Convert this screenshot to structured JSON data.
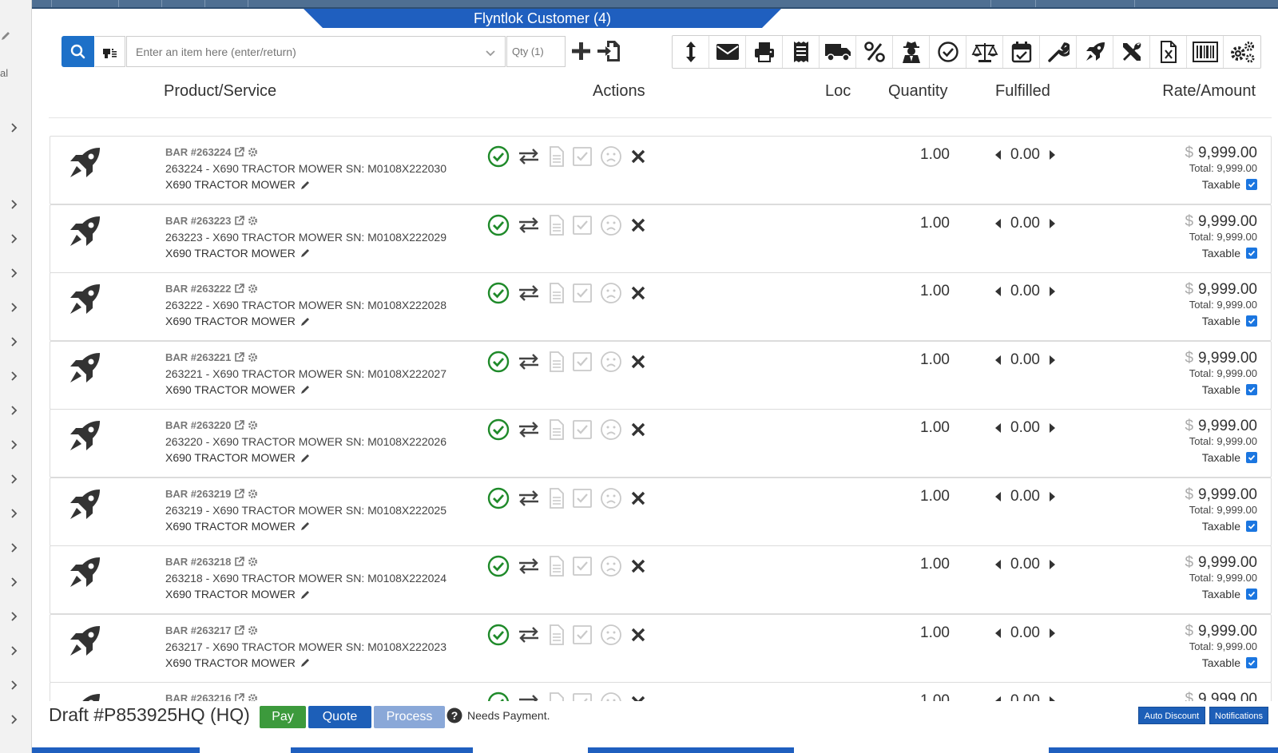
{
  "header": {
    "customer_tab": "Flyntlok Customer (4)",
    "accent": "#1f5fbf",
    "left_labels": [
      "al"
    ]
  },
  "search": {
    "placeholder": "Enter an item here (enter/return)",
    "qty_placeholder": "Qty (1)"
  },
  "toolbar": {
    "icons": [
      "sort-vertical-icon",
      "envelope-icon",
      "printer-icon",
      "receipt-icon",
      "truck-icon",
      "percent-icon",
      "user-secret-icon",
      "check-circle-icon",
      "balance-scale-icon",
      "calendar-check-icon",
      "wrench-icon",
      "rocket-icon",
      "tools-icon",
      "excel-file-icon",
      "barcode-icon",
      "cogs-icon"
    ]
  },
  "columns": {
    "product": "Product/Service",
    "actions": "Actions",
    "loc": "Loc",
    "quantity": "Quantity",
    "fulfilled": "Fulfilled",
    "rate": "Rate/Amount"
  },
  "rows": [
    {
      "bar": "BAR #263224",
      "desc": "263224 - X690 TRACTOR MOWER SN: M0108X222030",
      "name": "X690 TRACTOR MOWER",
      "qty": "1.00",
      "fulfilled": "0.00",
      "rate": "9,999.00",
      "total": "Total: 9,999.00",
      "taxable": "Taxable"
    },
    {
      "bar": "BAR #263223",
      "desc": "263223 - X690 TRACTOR MOWER SN: M0108X222029",
      "name": "X690 TRACTOR MOWER",
      "qty": "1.00",
      "fulfilled": "0.00",
      "rate": "9,999.00",
      "total": "Total: 9,999.00",
      "taxable": "Taxable"
    },
    {
      "bar": "BAR #263222",
      "desc": "263222 - X690 TRACTOR MOWER SN: M0108X222028",
      "name": "X690 TRACTOR MOWER",
      "qty": "1.00",
      "fulfilled": "0.00",
      "rate": "9,999.00",
      "total": "Total: 9,999.00",
      "taxable": "Taxable"
    },
    {
      "bar": "BAR #263221",
      "desc": "263221 - X690 TRACTOR MOWER SN: M0108X222027",
      "name": "X690 TRACTOR MOWER",
      "qty": "1.00",
      "fulfilled": "0.00",
      "rate": "9,999.00",
      "total": "Total: 9,999.00",
      "taxable": "Taxable"
    },
    {
      "bar": "BAR #263220",
      "desc": "263220 - X690 TRACTOR MOWER SN: M0108X222026",
      "name": "X690 TRACTOR MOWER",
      "qty": "1.00",
      "fulfilled": "0.00",
      "rate": "9,999.00",
      "total": "Total: 9,999.00",
      "taxable": "Taxable"
    },
    {
      "bar": "BAR #263219",
      "desc": "263219 - X690 TRACTOR MOWER SN: M0108X222025",
      "name": "X690 TRACTOR MOWER",
      "qty": "1.00",
      "fulfilled": "0.00",
      "rate": "9,999.00",
      "total": "Total: 9,999.00",
      "taxable": "Taxable"
    },
    {
      "bar": "BAR #263218",
      "desc": "263218 - X690 TRACTOR MOWER SN: M0108X222024",
      "name": "X690 TRACTOR MOWER",
      "qty": "1.00",
      "fulfilled": "0.00",
      "rate": "9,999.00",
      "total": "Total: 9,999.00",
      "taxable": "Taxable"
    },
    {
      "bar": "BAR #263217",
      "desc": "263217 - X690 TRACTOR MOWER SN: M0108X222023",
      "name": "X690 TRACTOR MOWER",
      "qty": "1.00",
      "fulfilled": "0.00",
      "rate": "9,999.00",
      "total": "Total: 9,999.00",
      "taxable": "Taxable"
    },
    {
      "bar": "BAR #263216",
      "desc": "",
      "name": "",
      "qty": "1.00",
      "fulfilled": "0.00",
      "rate": "9,999.00",
      "total": "",
      "taxable": ""
    }
  ],
  "footer": {
    "draft": "Draft #P853925HQ (HQ)",
    "pay": "Pay",
    "quote": "Quote",
    "process": "Process",
    "status": "Needs Payment.",
    "auto_discount": "Auto Discount",
    "notifications": "Notifications",
    "pay_color": "#3c9a3c",
    "quote_color": "#1d5fb8",
    "process_color": "#8aa8d8"
  }
}
